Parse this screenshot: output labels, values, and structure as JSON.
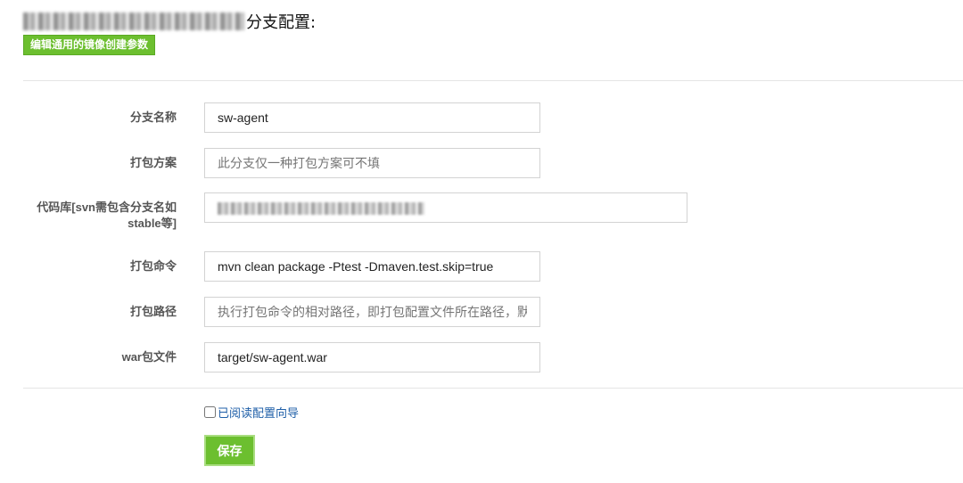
{
  "header": {
    "title_suffix": "分支配置:",
    "edit_button_label": "编辑通用的镜像创建参数"
  },
  "form": {
    "branch_name": {
      "label": "分支名称",
      "value": "sw-agent"
    },
    "package_scheme": {
      "label": "打包方案",
      "placeholder": "此分支仅一种打包方案可不填"
    },
    "repository": {
      "label_line1": "代码库[svn需包含分支名如",
      "label_line2": "stable等]"
    },
    "package_command": {
      "label": "打包命令",
      "value": "mvn clean package -Ptest -Dmaven.test.skip=true"
    },
    "package_path": {
      "label": "打包路径",
      "placeholder": "执行打包命令的相对路径，即打包配置文件所在路径，默"
    },
    "war_file": {
      "label": "war包文件",
      "value": "target/sw-agent.war"
    }
  },
  "guide": {
    "checkbox_label": "已阅读配置向导",
    "checked": false
  },
  "actions": {
    "save_label": "保存"
  },
  "colors": {
    "accent_green": "#6cbf2f",
    "link_blue": "#1f5fa8"
  }
}
